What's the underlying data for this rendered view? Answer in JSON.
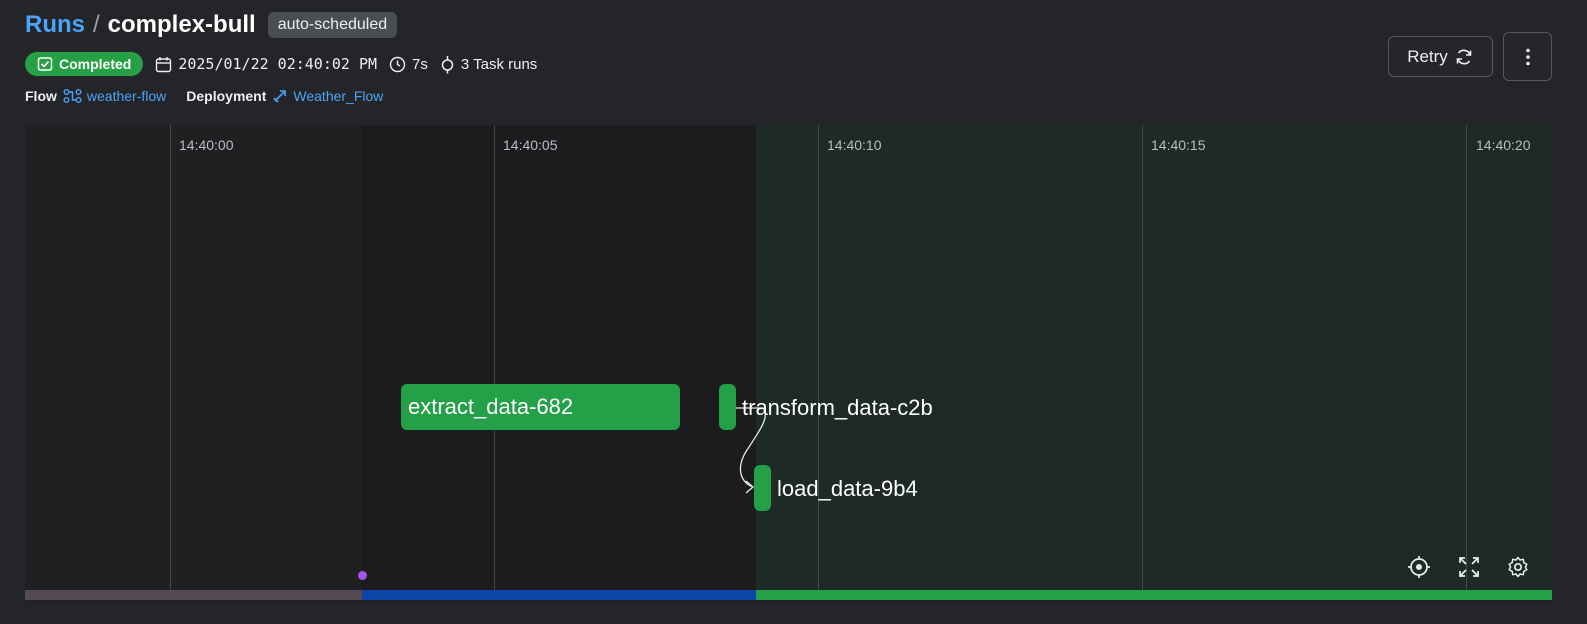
{
  "breadcrumb": {
    "runs": "Runs",
    "separator": "/",
    "run_name": "complex-bull"
  },
  "tag": "auto-scheduled",
  "meta": {
    "state": "Completed",
    "start_time": "2025/01/22 02:40:02 PM",
    "duration": "7s",
    "task_runs": "3 Task runs"
  },
  "relations": {
    "flow_label": "Flow",
    "flow_name": "weather-flow",
    "deployment_label": "Deployment",
    "deployment_name": "Weather_Flow"
  },
  "actions": {
    "retry": "Retry"
  },
  "timeline": {
    "ticks": [
      "14:40:00",
      "14:40:05",
      "14:40:10",
      "14:40:15",
      "14:40:20"
    ],
    "tasks": [
      {
        "name": "extract_data-682"
      },
      {
        "name": "transform_data-c2b"
      },
      {
        "name": "load_data-9b4"
      }
    ],
    "state_segments": [
      "Pending",
      "Running",
      "Completed"
    ]
  },
  "colors": {
    "completed": "#24a048",
    "running": "#0c44a8",
    "pending": "#544b55",
    "link": "#4ba3f7",
    "event": "#a156e8"
  },
  "icons": [
    "calendar-icon",
    "clock-icon",
    "task-run-icon",
    "flow-icon",
    "deployment-icon",
    "refresh-icon",
    "more-vertical-icon",
    "recenter-icon",
    "fullscreen-icon",
    "settings-icon",
    "check-square-icon"
  ]
}
